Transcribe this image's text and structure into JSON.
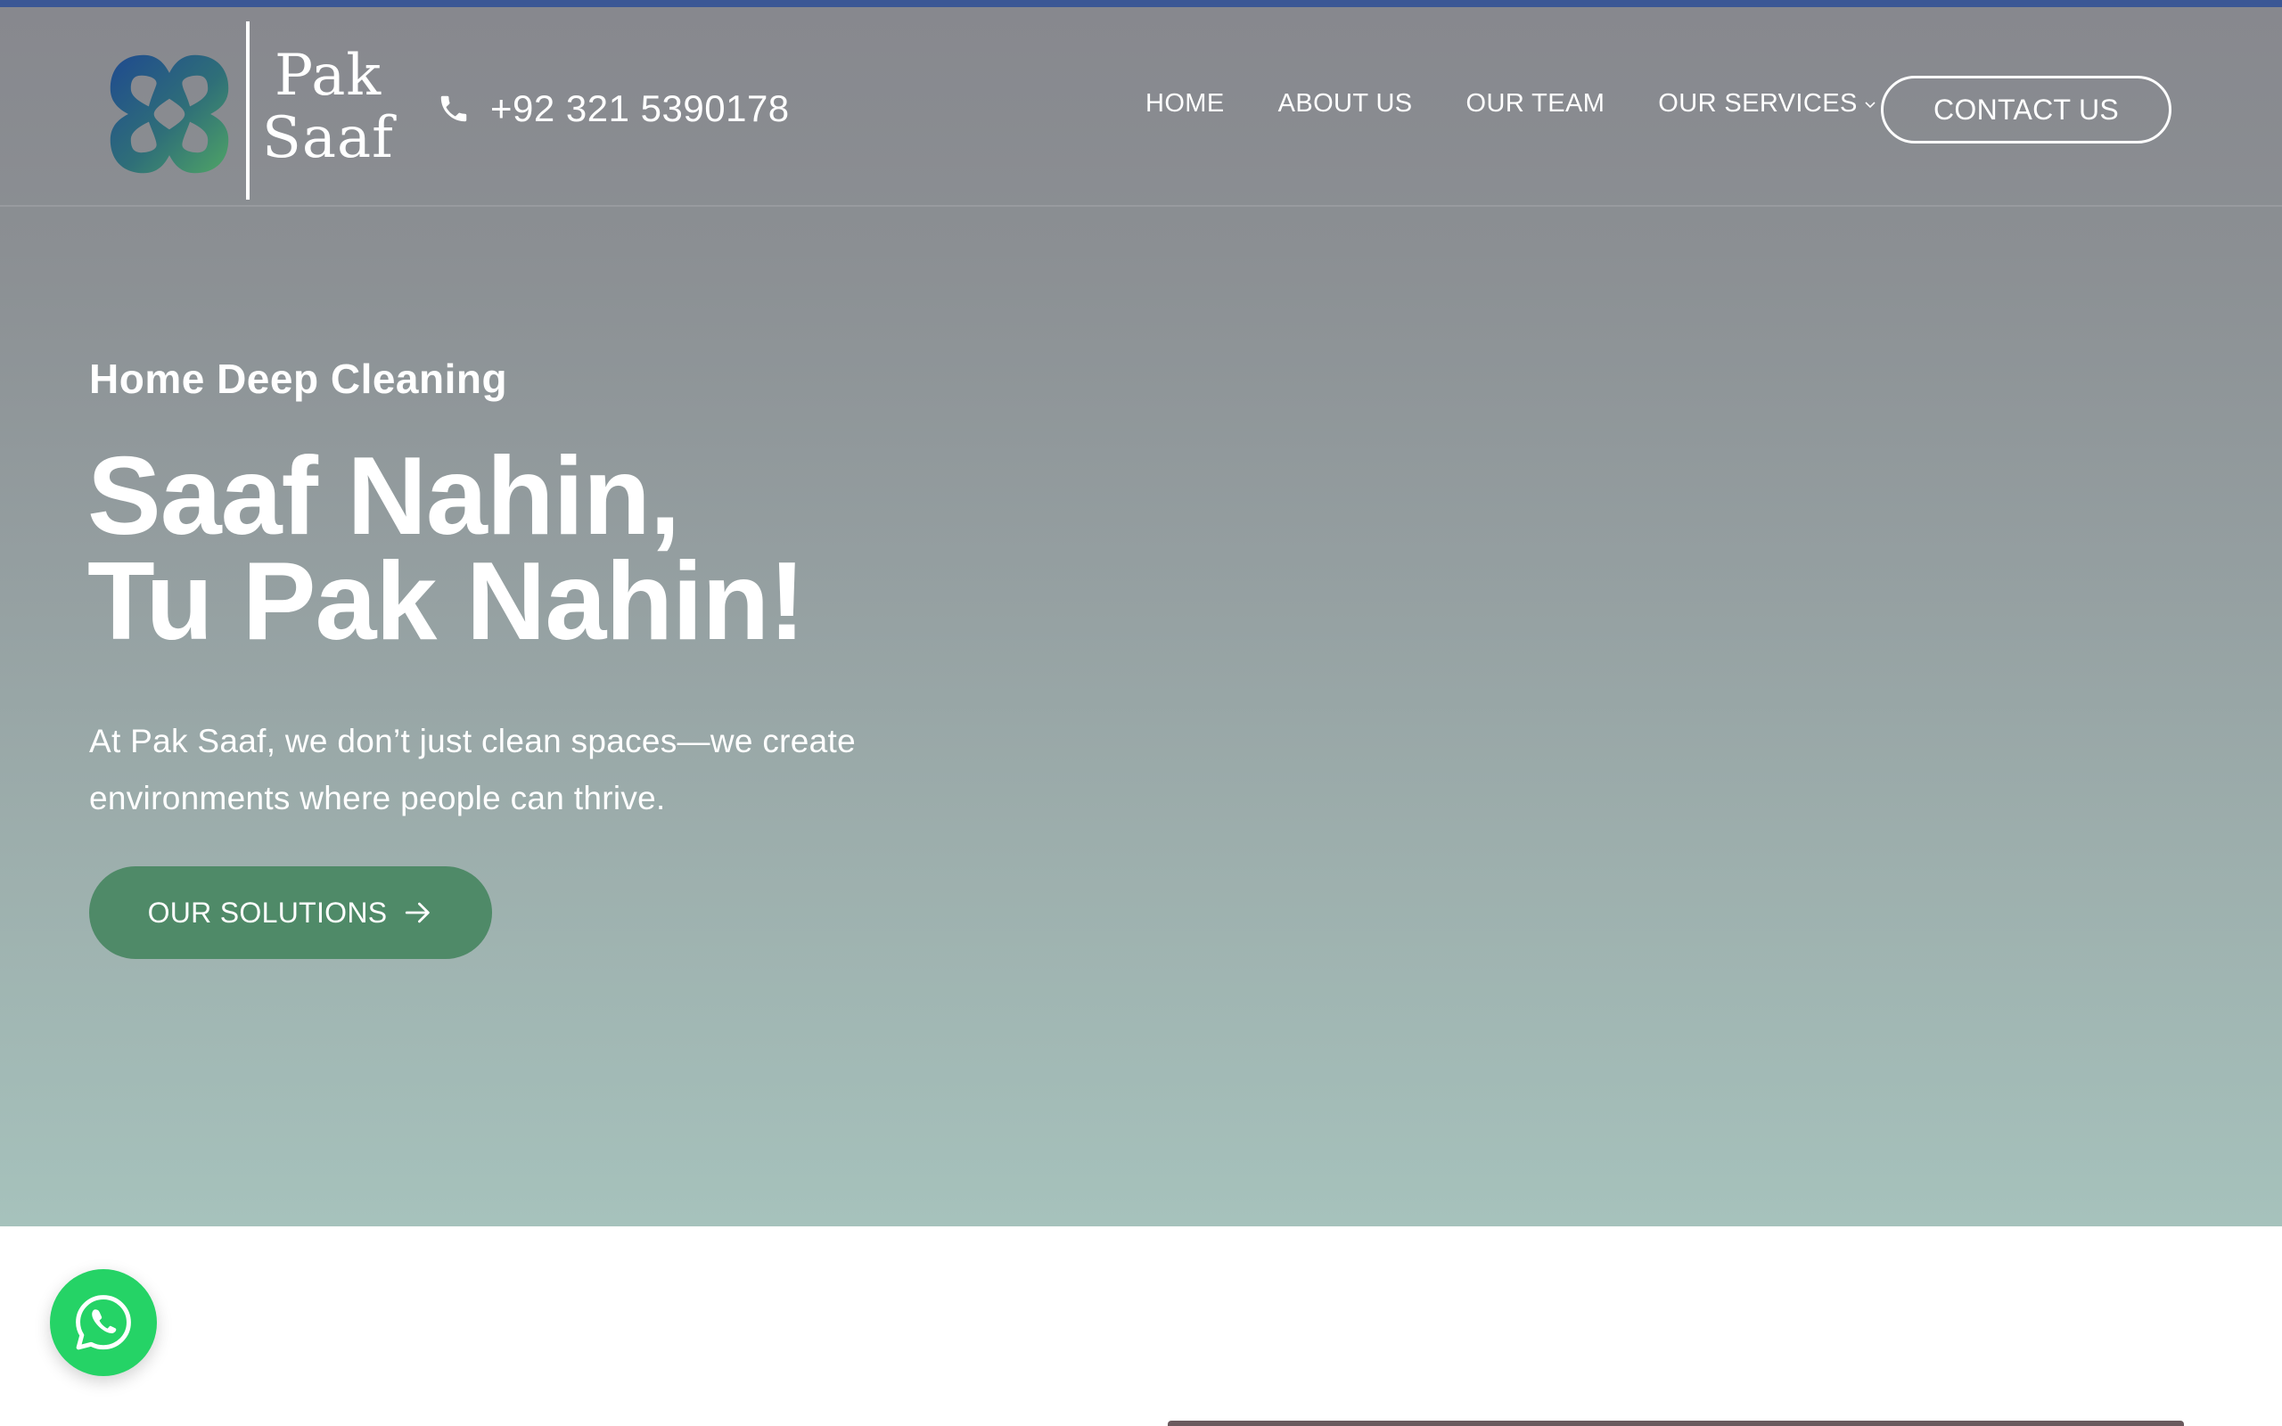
{
  "header": {
    "logo": {
      "line1": "Pak",
      "line2": "Saaf"
    },
    "phone": "+92 321 5390178",
    "nav": [
      {
        "label": "HOME"
      },
      {
        "label": "ABOUT US"
      },
      {
        "label": "OUR TEAM"
      },
      {
        "label": "OUR SERVICES"
      }
    ],
    "contact_label": "CONTACT US"
  },
  "hero": {
    "eyebrow": "Home Deep Cleaning",
    "headline_line1": "Saaf Nahin,",
    "headline_line2": "Tu Pak Nahin!",
    "subtext": "At Pak Saaf, we don’t just clean spaces—we create environments where people can thrive.",
    "cta_label": "OUR SOLUTIONS"
  },
  "colors": {
    "top_bar": "#3b5795",
    "cta_green": "#4f8a68",
    "whatsapp_green": "#25d366",
    "logo_blue": "#214b8a",
    "logo_green": "#3f9a62"
  },
  "icons": {
    "phone": "phone-icon",
    "services_chevron": "chevron-down-icon",
    "cta_arrow": "arrow-right-icon",
    "whatsapp": "whatsapp-icon",
    "logo": "clover-cross-logo"
  }
}
